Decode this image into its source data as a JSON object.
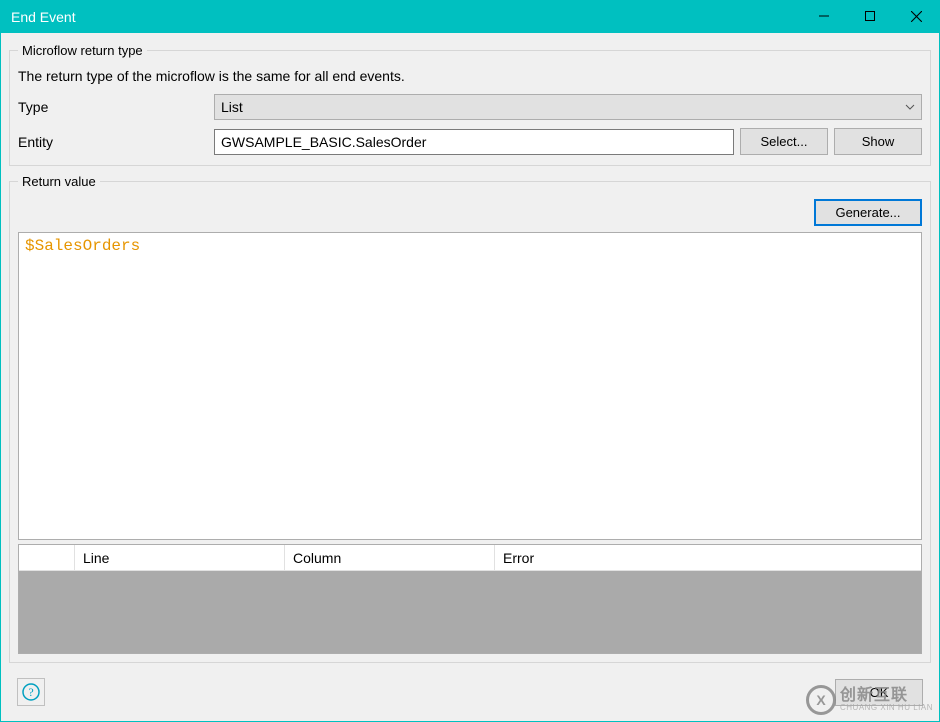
{
  "window": {
    "title": "End Event"
  },
  "returnType": {
    "legend": "Microflow return type",
    "description": "The return type of the microflow is the same for all end events.",
    "typeLabel": "Type",
    "typeValue": "List",
    "entityLabel": "Entity",
    "entityValue": "GWSAMPLE_BASIC.SalesOrder",
    "selectBtn": "Select...",
    "showBtn": "Show"
  },
  "returnValue": {
    "legend": "Return value",
    "generateBtn": "Generate...",
    "expression": "$SalesOrders",
    "errorHeaders": {
      "line": "Line",
      "column": "Column",
      "error": "Error"
    }
  },
  "footer": {
    "helpGlyph": "?",
    "okBtn": "OK"
  },
  "watermark": {
    "main": "创新互联",
    "sub": "CHUANG XIN HU LIAN"
  }
}
